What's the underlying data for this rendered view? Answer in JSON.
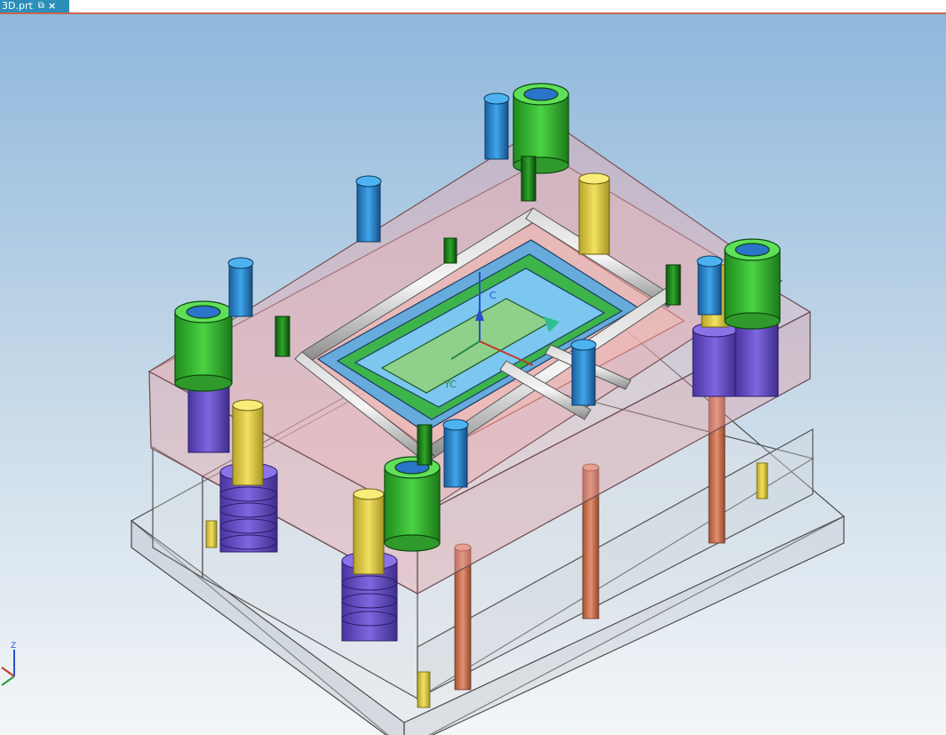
{
  "tab": {
    "filename": "3D.prt",
    "popout_icon": "popout-icon",
    "close_icon": "close-icon",
    "close_glyph": "×",
    "popout_glyph": "⧉"
  },
  "colors": {
    "tab_bg": "#2b8fb8",
    "accent_line": "#c8654d",
    "sky_top": "#8fb8dc",
    "sky_bottom": "#f4f6f8",
    "plate_pink": "#e8a7ac",
    "screw_blue": "#2a8fd6",
    "bushing_green": "#3ec23a",
    "pin_yellow": "#e9d54a",
    "spring_purple": "#6a4fd0",
    "rod_orange": "#d27a5a"
  },
  "viewport": {
    "csys_label": "YC",
    "csys_label2": "C",
    "triad_z_label": "Z"
  }
}
